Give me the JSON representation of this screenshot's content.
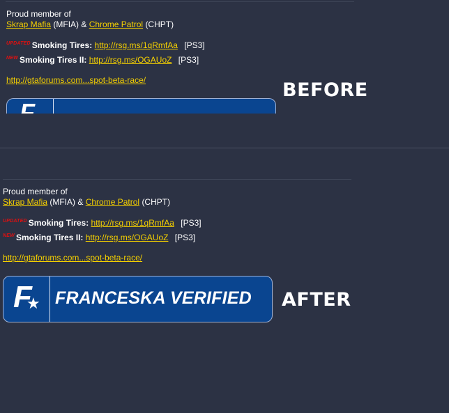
{
  "before": {
    "member_line": "Proud member of",
    "crew1_name": "Skrap Mafia",
    "crew1_tag": "(MFIA) &",
    "crew2_name": "Chrome Patrol",
    "crew2_tag": "(CHPT)",
    "updated_tag": "UPDATED",
    "race1_title": "Smoking Tires:",
    "race1_link": "http://rsg.ms/1qRmfAa",
    "race1_platform": "[PS3]",
    "new_tag": "NEW",
    "race2_title": "Smoking Tires II:",
    "race2_link": "http://rsg.ms/OGAUoZ",
    "race2_platform": "[PS3]",
    "forum_link": "http://gtaforums.com...spot-beta-race/",
    "badge_logo": "F",
    "label": "BEFORE"
  },
  "after": {
    "member_line": "Proud member of",
    "crew1_name": "Skrap Mafia",
    "crew1_tag": "(MFIA) &",
    "crew2_name": "Chrome Patrol",
    "crew2_tag": "(CHPT)",
    "updated_tag": "UPDATED",
    "race1_title": "Smoking Tires:",
    "race1_link": "http://rsg.ms/1qRmfAa",
    "race1_platform": "[PS3]",
    "new_tag": "NEW",
    "race2_title": "Smoking Tires II:",
    "race2_link": "http://rsg.ms/OGAUoZ",
    "race2_platform": "[PS3]",
    "forum_link": "http://gtaforums.com...spot-beta-race/",
    "badge_logo": "F",
    "badge_text": "FRANCESKA VERIFIED",
    "label": "AFTER"
  },
  "colors": {
    "background": "#2c3244",
    "link": "#f5d000",
    "tag_red": "#e01010",
    "badge_blue": "#0a4590"
  },
  "icons": {
    "badge_logo": "f-star-logo-icon"
  }
}
